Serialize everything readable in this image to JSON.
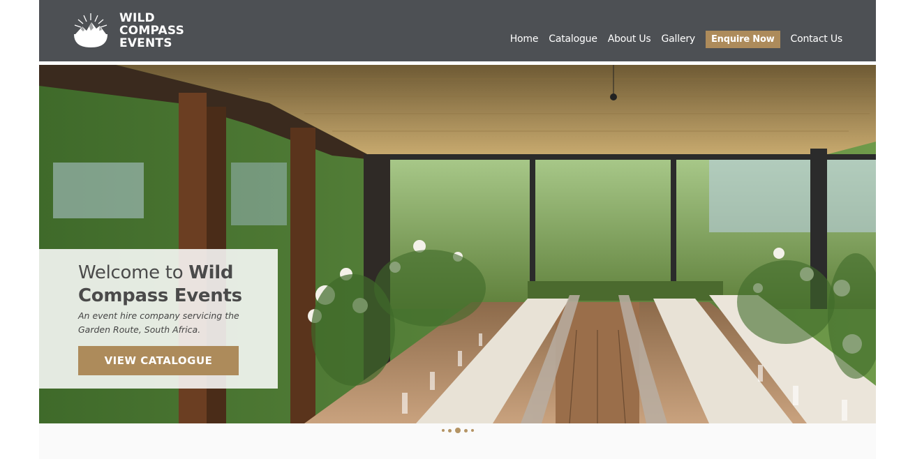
{
  "brand": {
    "logo_lines": [
      "WILD",
      "COMPASS",
      "EVENTS"
    ],
    "logo_icon": "sun-mountain-logo-icon",
    "header_bg": "#4d5054",
    "accent": "#ad8b5b"
  },
  "nav": {
    "items": [
      {
        "label": "Home",
        "highlight": false
      },
      {
        "label": "Catalogue",
        "highlight": false
      },
      {
        "label": "About Us",
        "highlight": false
      },
      {
        "label": "Gallery",
        "highlight": false
      },
      {
        "label": "Enquire Now",
        "highlight": true
      },
      {
        "label": "Contact Us",
        "highlight": false
      }
    ]
  },
  "hero": {
    "welcome_prefix": "Welcome to ",
    "welcome_bold": "Wild Compass Events",
    "tagline": "An event hire company servicing the Garden Route, South Africa.",
    "button_label": "VIEW CATALOGUE",
    "slide_count": 5,
    "active_slide": 3
  }
}
